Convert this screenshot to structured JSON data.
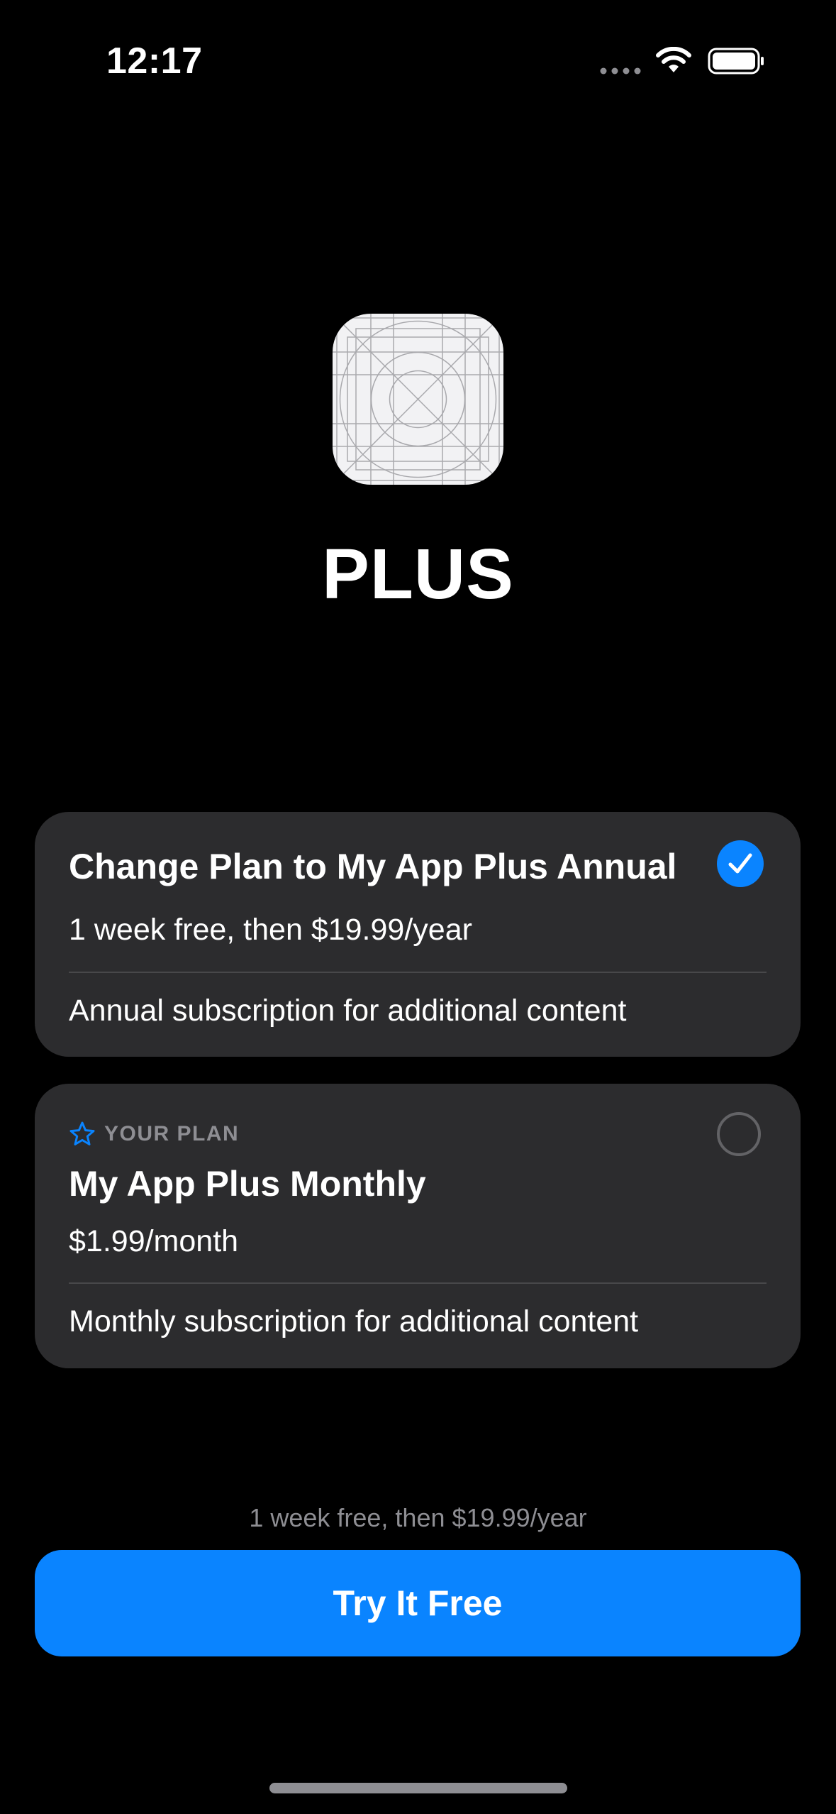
{
  "status_bar": {
    "time": "12:17",
    "signal_icon": "cellular-signal-icon",
    "wifi_icon": "wifi-icon",
    "battery_icon": "battery-full-icon"
  },
  "app": {
    "icon": "app-icon-grid-template",
    "title": "PLUS"
  },
  "plans": [
    {
      "name": "Change Plan to My App Plus Annual",
      "price": "1 week free, then $19.99/year",
      "description": "Annual subscription for additional content",
      "selected": true,
      "selection_icon": "checkmark-circle-icon"
    },
    {
      "badge_icon": "star-icon",
      "badge_label": "YOUR PLAN",
      "name": "My App Plus Monthly",
      "price": "$1.99/month",
      "description": "Monthly subscription for additional content",
      "selected": false,
      "selection_icon": "empty-radio-icon"
    }
  ],
  "footer": {
    "note": "1 week free, then $19.99/year",
    "cta_label": "Try It Free"
  },
  "colors": {
    "background": "#000000",
    "card": "#2c2c2e",
    "accent": "#0a84ff",
    "secondary_text": "#8e8e93"
  }
}
